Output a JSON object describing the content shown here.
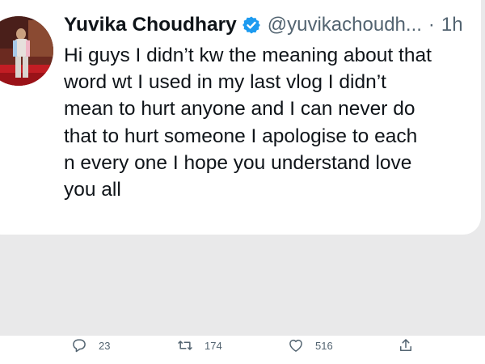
{
  "tweet": {
    "author_name": "Yuvika Choudhary",
    "verified_icon": "verified-badge-icon",
    "handle": "@yuvikachoudh...",
    "separator": "·",
    "time": "1h",
    "text": "Hi guys I didn’t kw the meaning about that\nword  wt I used in my last vlog I didn’t\nmean to hurt anyone and I can never do\nthat to hurt  someone  I apologise to each\nn every one I hope you understand love\nyou all",
    "avatar_icon": "profile-photo"
  },
  "actions": {
    "reply_icon": "reply-icon",
    "reply_count": "23",
    "retweet_icon": "retweet-icon",
    "retweet_count": "174",
    "like_icon": "like-heart-icon",
    "like_count": "516",
    "share_icon": "share-icon"
  },
  "colors": {
    "verified": "#1d9bf0",
    "text": "#0f1419",
    "secondary": "#536471",
    "background": "#e9e9ea"
  }
}
